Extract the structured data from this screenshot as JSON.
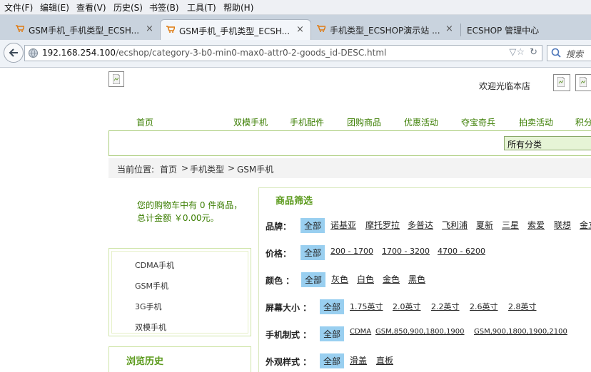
{
  "menu": [
    "文件(F)",
    "编辑(E)",
    "查看(V)",
    "历史(S)",
    "书签(B)",
    "工具(T)",
    "帮助(H)"
  ],
  "tabs": [
    {
      "label": "GSM手机_手机类型_ECSH...",
      "close": "×"
    },
    {
      "label": "GSM手机_手机类型_ECSH...",
      "close": "×"
    },
    {
      "label": "手机类型_ECSHOP演示站 ...",
      "close": "×"
    },
    {
      "label": "ECSHOP 管理中心"
    }
  ],
  "address": {
    "host": "192.168.254.100",
    "path": "/ecshop/category-3-b0-min0-max0-attr0-2-goods_id-DESC.html"
  },
  "search": {
    "placeholder": "搜索"
  },
  "page": {
    "welcome": "欢迎光临本店",
    "nav": [
      "首页",
      "双模手机",
      "手机配件",
      "团购商品",
      "优惠活动",
      "夺宝奇兵",
      "拍卖活动",
      "积分"
    ],
    "category_select": "所有分类",
    "breadcrumb": {
      "prefix": "当前位置:",
      "home": "首页",
      "sep": ">",
      "level1": "手机类型",
      "level2": "GSM手机"
    },
    "cart_text": "您的购物车中有 0 件商品，总计金额 ￥0.00元。",
    "categories": [
      "CDMA手机",
      "GSM手机",
      "3G手机",
      "双模手机"
    ],
    "history_title": "浏览历史",
    "filter_title": "商品筛选",
    "filters": [
      {
        "key": "品牌：",
        "options": [
          "全部",
          "诺基亚",
          "摩托罗拉",
          "多普达",
          "飞利浦",
          "夏新",
          "三星",
          "索爱",
          "联想",
          "金立"
        ]
      },
      {
        "key": "价格：",
        "options": [
          "全部",
          "200 - 1700",
          "1700 - 3200",
          "4700 - 6200"
        ]
      },
      {
        "key": "颜色 ：",
        "options": [
          "全部",
          "灰色",
          "白色",
          "金色",
          "黑色"
        ]
      },
      {
        "key": "屏幕大小 ：",
        "options": [
          "全部",
          "1.75英寸",
          "2.0英寸",
          "2.2英寸",
          "2.6英寸",
          "2.8英寸"
        ]
      },
      {
        "key": "手机制式 ：",
        "options": [
          "全部",
          "CDMA",
          "GSM,850,900,1800,1900",
          "GSM,900,1800,1900,2100"
        ]
      },
      {
        "key": "外观样式 ：",
        "options": [
          "全部",
          "滑盖",
          "直板"
        ]
      }
    ]
  },
  "colors": {
    "accent_green": "#3a7d00",
    "selected_option": "#99cff0",
    "tab_bar": "#c9d3de"
  }
}
